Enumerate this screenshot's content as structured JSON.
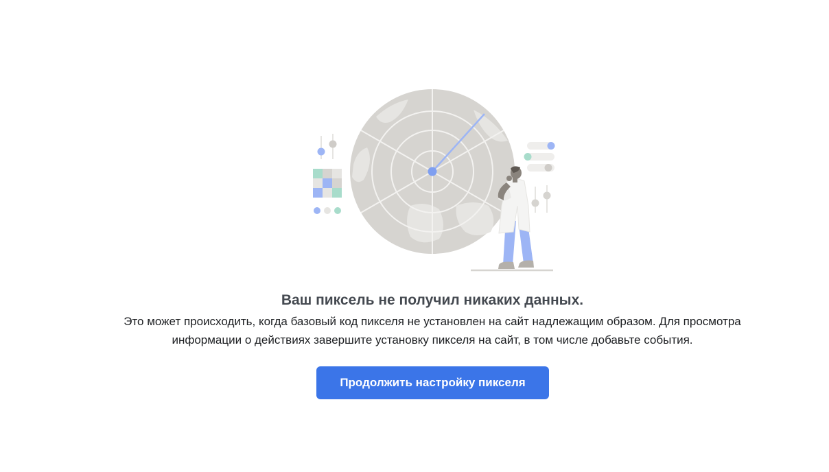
{
  "empty_state": {
    "illustration_icon": "radar-scientist-illustration",
    "title": "Ваш пиксель не получил никаких данных.",
    "description_line1": "Это может происходить, когда базовый код пикселя не установлен на сайт надлежащим образом. Для просмотра",
    "description_line2": "информации о действиях завершите установку пикселя на сайт, в том числе добавьте события.",
    "button_label": "Продолжить настройку пикселя"
  },
  "colors": {
    "accent": "#3b75e8",
    "title": "#444950",
    "text": "#1c1e21",
    "radar": "#d6d4d0",
    "radar_light": "#e6e5e2",
    "accent_light": "#9db5f5",
    "teal": "#a8dccb"
  }
}
